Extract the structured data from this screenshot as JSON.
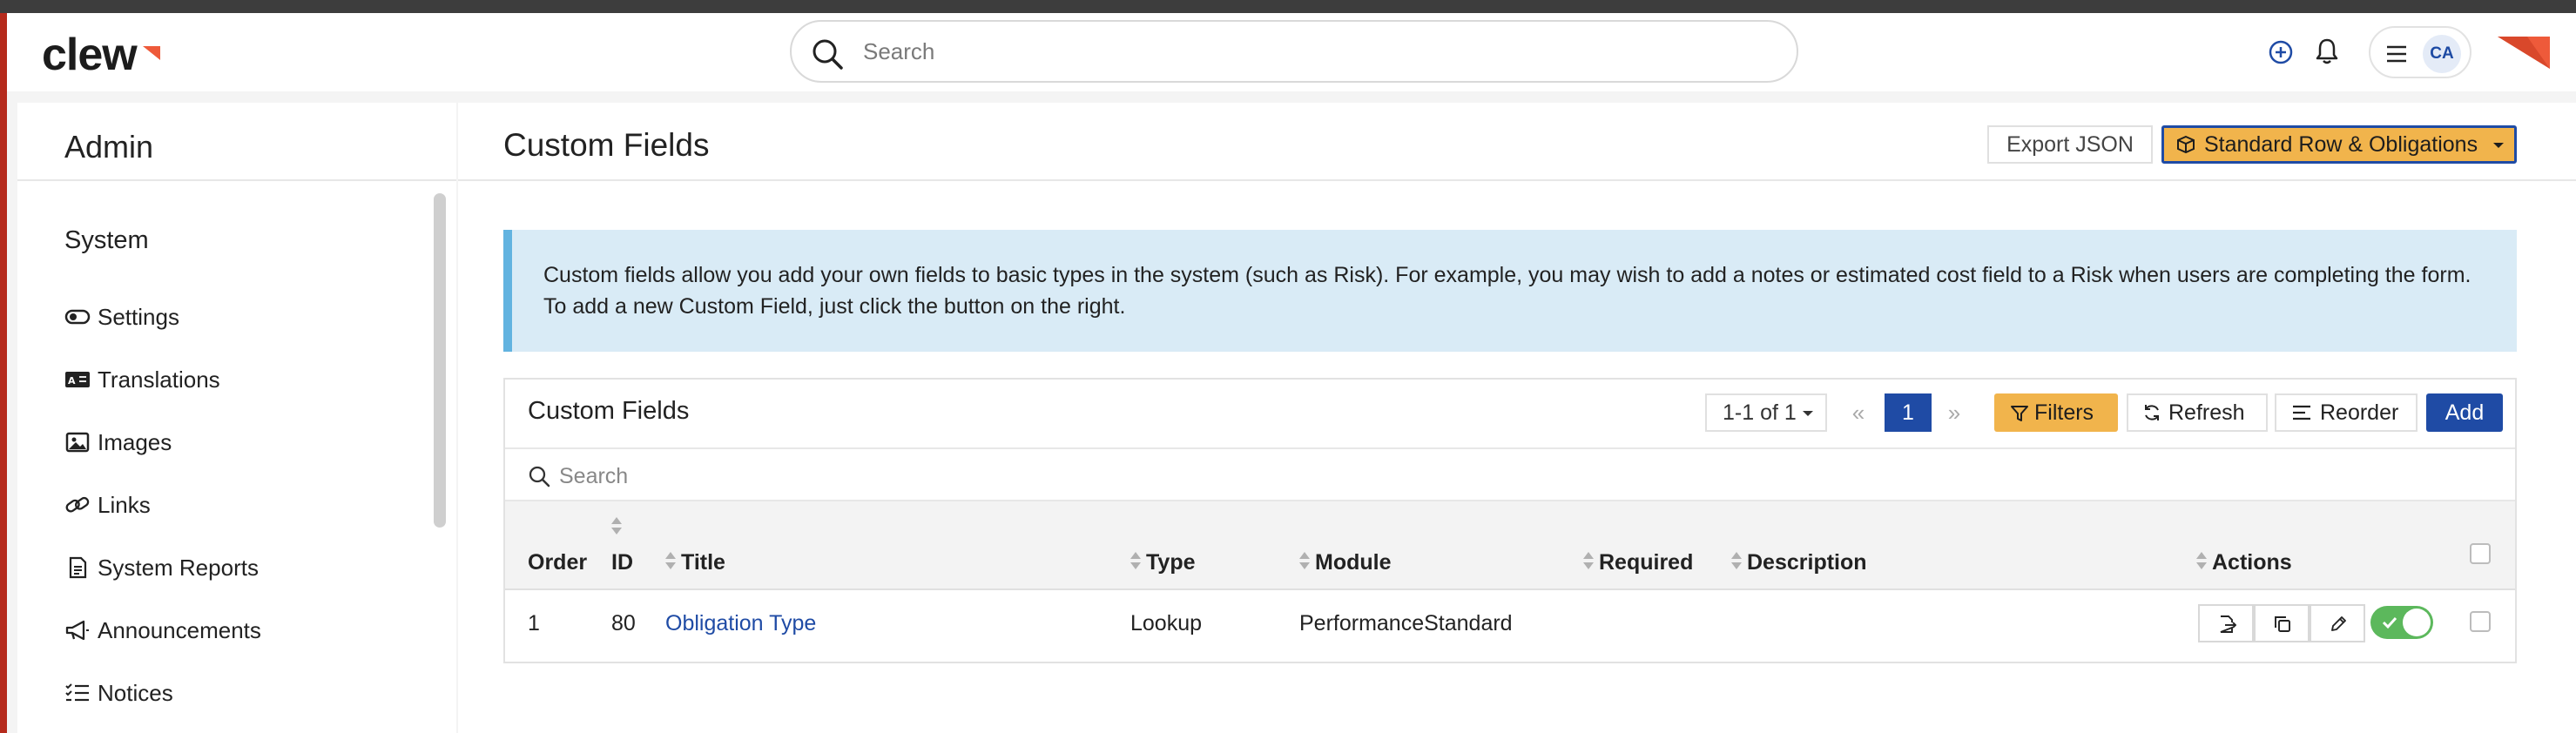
{
  "app": {
    "logo_text": "clew"
  },
  "header": {
    "search_placeholder": "Search",
    "avatar_initials": "CA"
  },
  "sidebar": {
    "title": "Admin",
    "section": "System",
    "items": [
      {
        "label": "Settings",
        "icon": "toggle-icon"
      },
      {
        "label": "Translations",
        "icon": "translate-icon"
      },
      {
        "label": "Images",
        "icon": "image-icon"
      },
      {
        "label": "Links",
        "icon": "link-icon"
      },
      {
        "label": "System Reports",
        "icon": "report-icon"
      },
      {
        "label": "Announcements",
        "icon": "megaphone-icon"
      },
      {
        "label": "Notices",
        "icon": "list-icon"
      }
    ]
  },
  "main": {
    "title": "Custom Fields",
    "export_label": "Export JSON",
    "standard_label": "Standard Row & Obligations",
    "info_text": "Custom fields allow you add your own fields to basic types in the system (such as Risk). For example, you may wish to add a notes or estimated cost field to a Risk when users are completing the form. To add a new Custom Field, just click the button on the right."
  },
  "table_card": {
    "title": "Custom Fields",
    "range": "1-1 of 1",
    "page_first": "«",
    "page_current": "1",
    "page_last": "»",
    "filters_label": "Filters",
    "refresh_label": "Refresh",
    "reorder_label": "Reorder",
    "add_label": "Add",
    "search_placeholder": "Search",
    "columns": [
      "Order",
      "ID",
      "Title",
      "Type",
      "Module",
      "Required",
      "Description",
      "Actions"
    ],
    "rows": [
      {
        "order": "1",
        "id": "80",
        "title": "Obligation Type",
        "type": "Lookup",
        "module": "PerformanceStandard",
        "required": "",
        "description": "",
        "enabled": true
      }
    ]
  },
  "colors": {
    "accent_blue": "#1f4ba5",
    "accent_orange": "#f1b44c",
    "info_bg": "#d9ebf6",
    "toggle_on": "#5cb85c",
    "brand_red": "#b52a1c"
  }
}
